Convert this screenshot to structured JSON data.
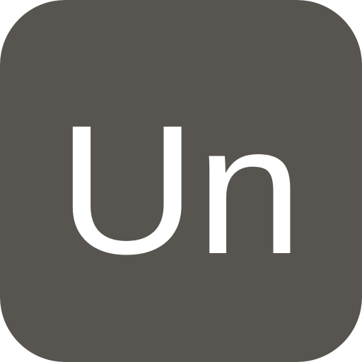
{
  "app_icon": {
    "monogram": "Un",
    "background_color": "#585550",
    "text_color": "#ffffff"
  }
}
